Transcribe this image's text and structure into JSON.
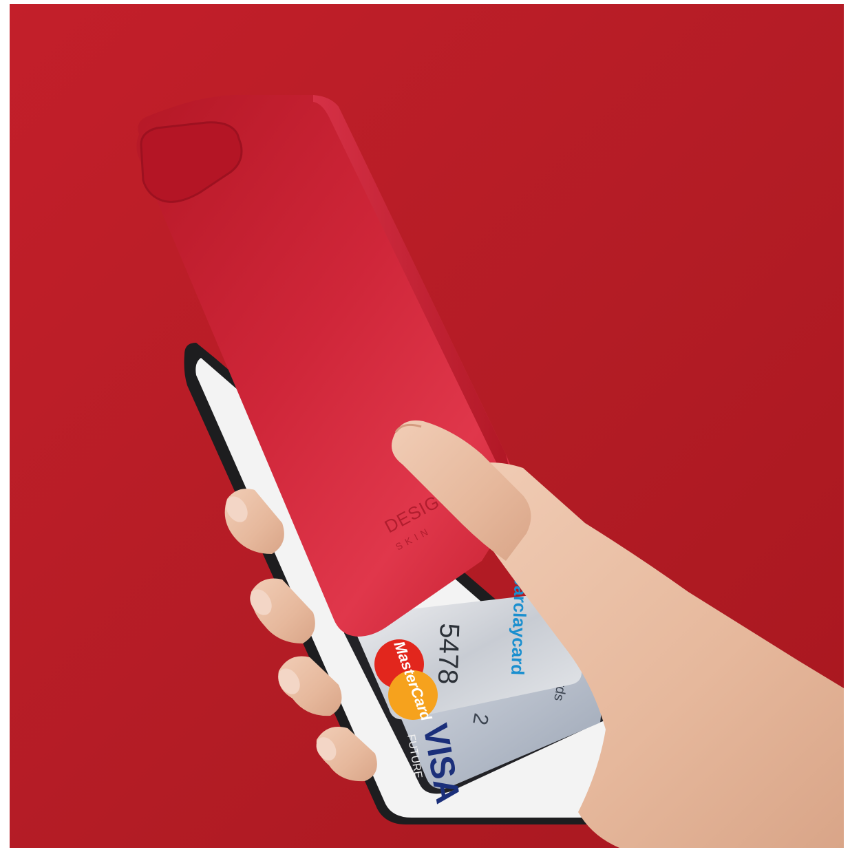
{
  "image": {
    "kind": "product-photo",
    "subject": "slide card-holder phone case",
    "colors": {
      "background": "#b01c24",
      "case_red": "#c8202e",
      "case_highlight": "#e23a4c",
      "tray_white": "#f4f4f4",
      "frame_black": "#1d1d1f",
      "skin": "#e9c2a8"
    }
  },
  "case_logo": {
    "line1": "DESIGN",
    "line2": "SKIN"
  },
  "cards": {
    "barclaycard": {
      "brand": "barclaycard",
      "digits": "5478",
      "mastercard_label": "MasterCard"
    },
    "visa": {
      "brand": "VISA",
      "subtext": "FUTURE",
      "number_fragment": "2",
      "edge_text": "rds"
    }
  }
}
